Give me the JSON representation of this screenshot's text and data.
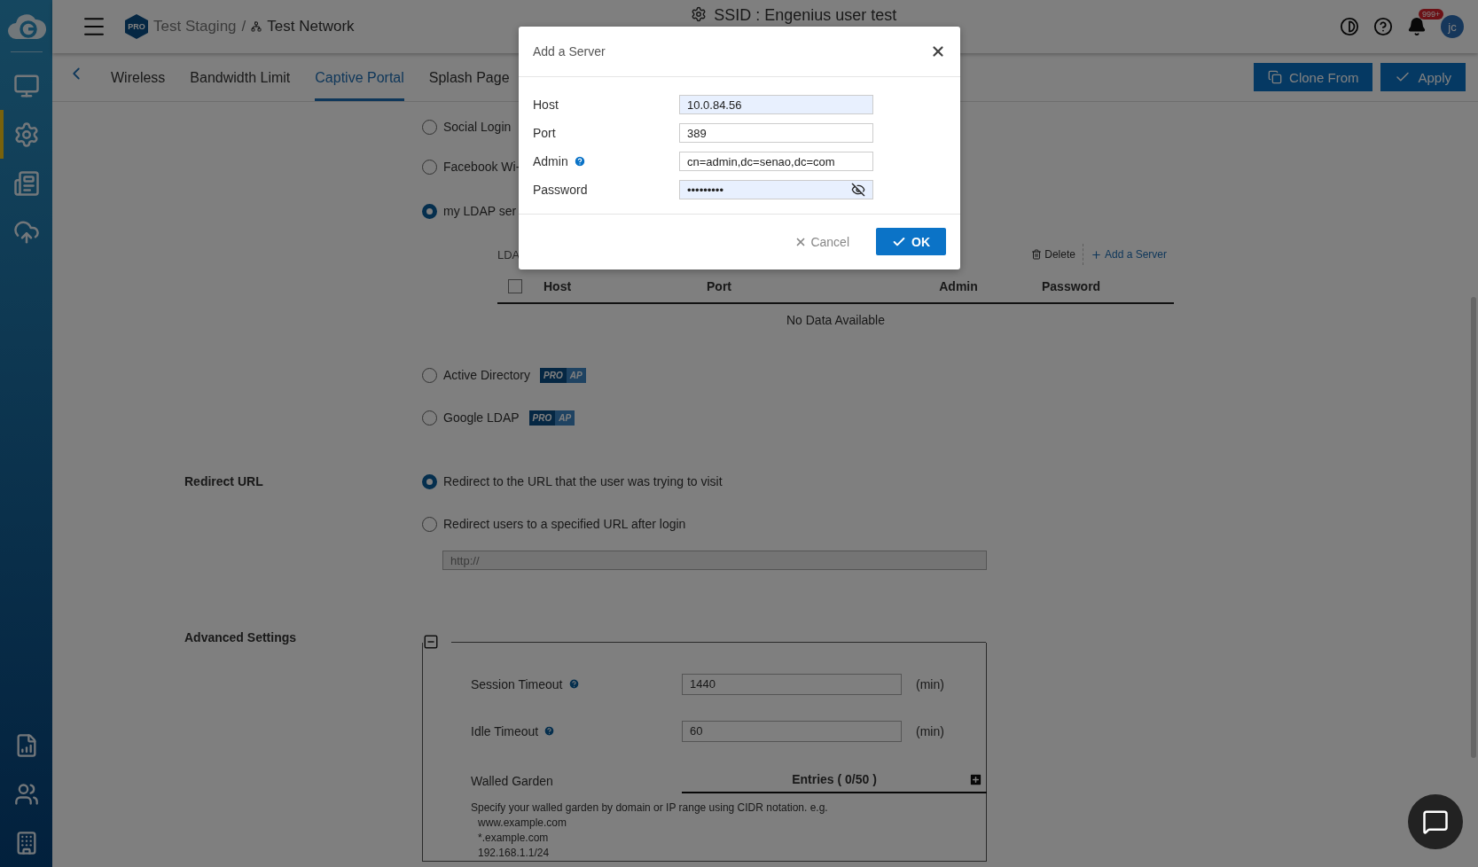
{
  "breadcrumb": {
    "badge": "PRO",
    "org": "Test Staging",
    "separator": "/",
    "network": "Test Network"
  },
  "page_title": "SSID : Engenius user test",
  "notifications": {
    "count": "999+"
  },
  "avatar": {
    "initials": "jc"
  },
  "sidebar": {
    "items": [
      {
        "selected": false
      },
      {
        "selected": true
      },
      {
        "selected": false
      },
      {
        "selected": false
      }
    ]
  },
  "tabs": [
    {
      "label": "Wireless",
      "selected": false
    },
    {
      "label": "Bandwidth Limit",
      "selected": false
    },
    {
      "label": "Captive Portal",
      "selected": true
    },
    {
      "label": "Splash Page",
      "selected": false
    }
  ],
  "actions": [
    "Clone From",
    "Apply"
  ],
  "auth_options": [
    {
      "label": "Social Login",
      "selected": false
    },
    {
      "label": "Facebook Wi-",
      "selected": false
    },
    {
      "label": "my LDAP ser",
      "selected": true
    }
  ],
  "ldap": {
    "label": "LDA",
    "all_checked": false,
    "delete": "Delete",
    "add": "Add a Server",
    "columns": [
      "Host",
      "Port",
      "Admin",
      "Password"
    ],
    "empty": "No Data Available"
  },
  "pro_options": [
    {
      "label": "Active Directory",
      "selected": false,
      "badge": [
        "PRO",
        "AP"
      ]
    },
    {
      "label": "Google LDAP",
      "selected": false,
      "badge": [
        "PRO",
        "AP"
      ]
    }
  ],
  "redirect": {
    "label": "Redirect URL",
    "options": [
      {
        "label": "Redirect to the URL that the user was trying to visit",
        "selected": true
      },
      {
        "label": "Redirect users to a specified URL after login",
        "selected": false
      }
    ],
    "url_placeholder": "http://"
  },
  "advanced": {
    "label": "Advanced Settings",
    "expanded": true,
    "fields": [
      {
        "label": "Session Timeout",
        "value": "1440",
        "unit": "(min)"
      },
      {
        "label": "Idle Timeout",
        "value": "60",
        "unit": "(min)"
      }
    ],
    "walled_garden": {
      "label": "Walled Garden",
      "entries": "Entries ( 0/50 )",
      "help": "Specify your walled garden by domain or IP range using CIDR notation. e.g.",
      "examples": [
        "www.example.com",
        "*.example.com",
        "192.168.1.1/24"
      ]
    }
  },
  "dialog": {
    "title": "Add a Server",
    "fields": [
      {
        "label": "Host",
        "value": "10.0.84.56",
        "kind": "text",
        "autofilled": true
      },
      {
        "label": "Port",
        "value": "389",
        "kind": "text",
        "autofilled": false
      },
      {
        "label": "Admin",
        "value": "cn=admin,dc=senao,dc=com",
        "kind": "text",
        "help": true,
        "autofilled": false
      },
      {
        "label": "Password",
        "value": "•••••••••",
        "kind": "password",
        "autofilled": true
      }
    ],
    "cancel": "Cancel",
    "ok": "OK"
  }
}
